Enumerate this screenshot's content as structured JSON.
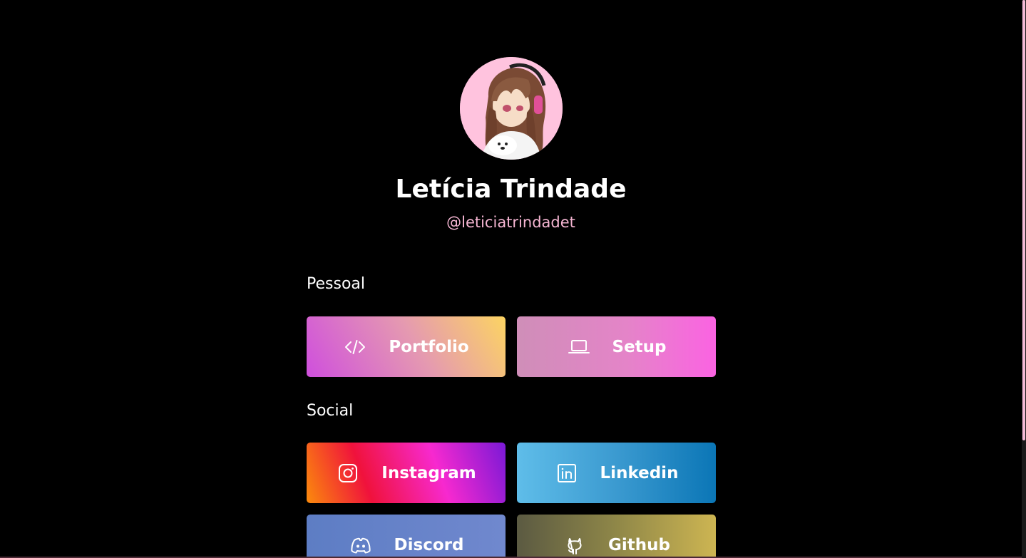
{
  "profile": {
    "name": "Letícia Trindade",
    "handle": "@leticiatrindadet"
  },
  "sections": {
    "personal": {
      "title": "Pessoal",
      "links": [
        {
          "label": "Portfolio",
          "icon": "code-icon"
        },
        {
          "label": "Setup",
          "icon": "laptop-icon"
        }
      ]
    },
    "social": {
      "title": "Social",
      "links": [
        {
          "label": "Instagram",
          "icon": "instagram-icon"
        },
        {
          "label": "Linkedin",
          "icon": "linkedin-icon"
        },
        {
          "label": "Discord",
          "icon": "discord-icon"
        },
        {
          "label": "Github",
          "icon": "github-icon"
        }
      ]
    }
  },
  "colors": {
    "background": "#000000",
    "handle": "#f6b6d3",
    "avatar_background": "#ffc3de",
    "scrollbar_thumb": "#f3b9d5"
  }
}
